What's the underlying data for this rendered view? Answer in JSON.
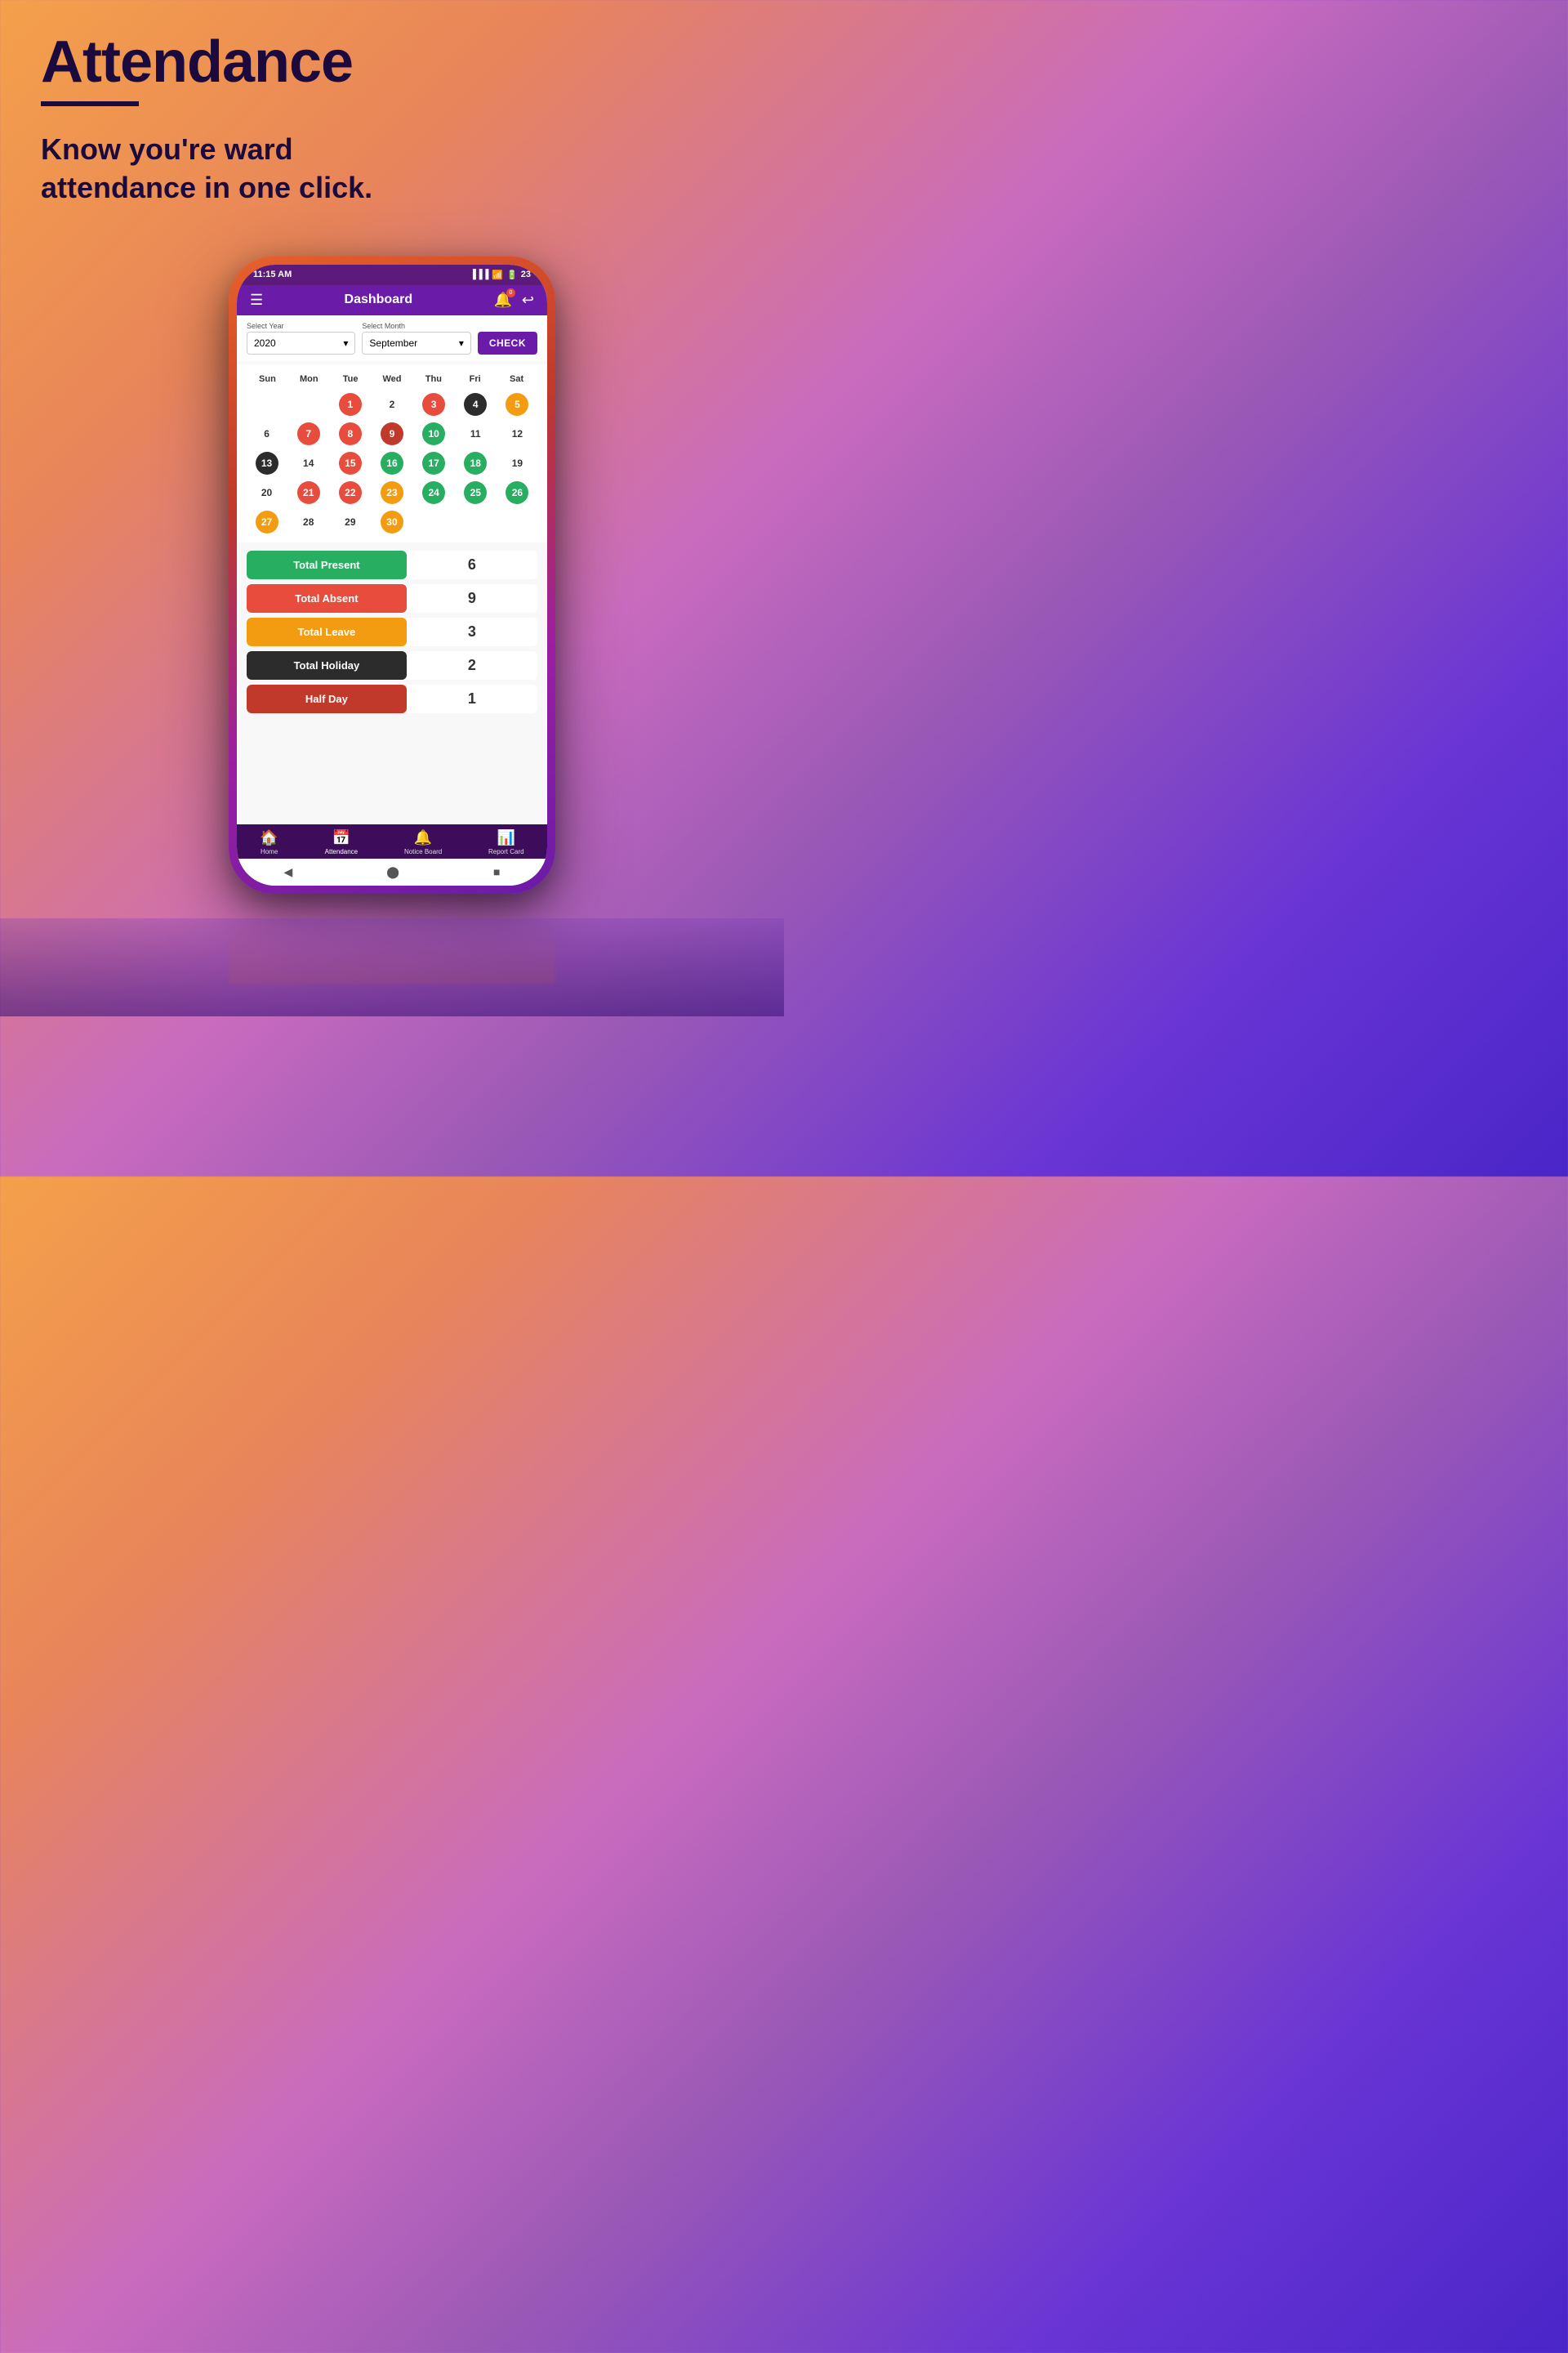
{
  "header": {
    "title": "Attendance",
    "underline": true,
    "subtitle": "Know you're ward attendance in one click."
  },
  "statusBar": {
    "time": "11:15 AM",
    "battery": "23",
    "wifi": true,
    "signal": true
  },
  "navbar": {
    "title": "Dashboard",
    "notificationBadge": "0"
  },
  "filters": {
    "yearLabel": "Select Year",
    "yearValue": "2020",
    "monthLabel": "Select Month",
    "monthValue": "September",
    "checkButton": "CHECK"
  },
  "calendar": {
    "dayNames": [
      "Sun",
      "Mon",
      "Tue",
      "Wed",
      "Thu",
      "Fri",
      "Sat"
    ],
    "weeks": [
      [
        {
          "day": "",
          "type": "empty"
        },
        {
          "day": "",
          "type": "empty"
        },
        {
          "day": "1",
          "type": "red"
        },
        {
          "day": "2",
          "type": "plain"
        },
        {
          "day": "3",
          "type": "red"
        },
        {
          "day": "4",
          "type": "dark"
        },
        {
          "day": "5",
          "type": "orange"
        }
      ],
      [
        {
          "day": "6",
          "type": "plain"
        },
        {
          "day": "7",
          "type": "red"
        },
        {
          "day": "8",
          "type": "red"
        },
        {
          "day": "9",
          "type": "pink"
        },
        {
          "day": "10",
          "type": "green"
        },
        {
          "day": "11",
          "type": "plain"
        },
        {
          "day": "12",
          "type": "plain"
        }
      ],
      [
        {
          "day": "13",
          "type": "dark"
        },
        {
          "day": "14",
          "type": "plain"
        },
        {
          "day": "15",
          "type": "red"
        },
        {
          "day": "16",
          "type": "green"
        },
        {
          "day": "17",
          "type": "green"
        },
        {
          "day": "18",
          "type": "green"
        },
        {
          "day": "19",
          "type": "plain"
        }
      ],
      [
        {
          "day": "20",
          "type": "plain"
        },
        {
          "day": "21",
          "type": "red"
        },
        {
          "day": "22",
          "type": "red"
        },
        {
          "day": "23",
          "type": "orange"
        },
        {
          "day": "24",
          "type": "green"
        },
        {
          "day": "25",
          "type": "green"
        },
        {
          "day": "26",
          "type": "green"
        }
      ],
      [
        {
          "day": "27",
          "type": "orange"
        },
        {
          "day": "28",
          "type": "plain"
        },
        {
          "day": "29",
          "type": "plain"
        },
        {
          "day": "30",
          "type": "orange"
        },
        {
          "day": "",
          "type": "empty"
        },
        {
          "day": "",
          "type": "empty"
        },
        {
          "day": "",
          "type": "empty"
        }
      ]
    ]
  },
  "stats": [
    {
      "label": "Total Present",
      "value": "6",
      "color": "bg-green"
    },
    {
      "label": "Total Absent",
      "value": "9",
      "color": "bg-red"
    },
    {
      "label": "Total Leave",
      "value": "3",
      "color": "bg-orange"
    },
    {
      "label": "Total Holiday",
      "value": "2",
      "color": "bg-dark"
    },
    {
      "label": "Half Day",
      "value": "1",
      "color": "bg-pink"
    }
  ],
  "bottomNav": [
    {
      "label": "Home",
      "icon": "🏠",
      "active": false
    },
    {
      "label": "Attendance",
      "icon": "📅",
      "active": true
    },
    {
      "label": "Notice Board",
      "icon": "🔔",
      "active": false
    },
    {
      "label": "Report Card",
      "icon": "📊",
      "active": false
    }
  ]
}
